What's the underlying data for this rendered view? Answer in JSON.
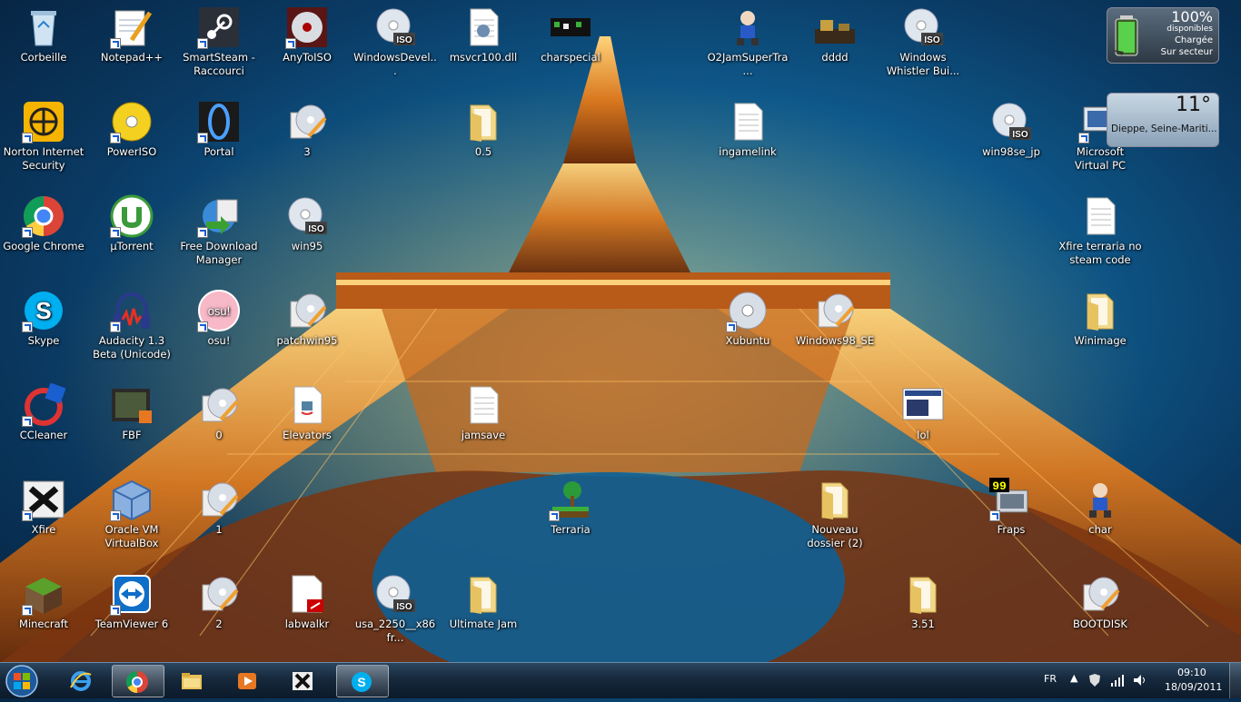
{
  "desktop_icons": [
    {
      "label": "Corbeille",
      "icon": "recycle-bin-icon"
    },
    {
      "label": "Notepad++",
      "icon": "notepad-plus-plus-icon"
    },
    {
      "label": "SmartSteam - Raccourci",
      "icon": "steam-icon"
    },
    {
      "label": "AnyToISO",
      "icon": "disc-red-icon"
    },
    {
      "label": "WindowsDevel...",
      "icon": "iso-disc-icon"
    },
    {
      "label": "msvcr100.dll",
      "icon": "dll-file-icon"
    },
    {
      "label": "charspecial",
      "icon": "pixel-art-icon"
    },
    {
      "label": "O2JamSuperTra...",
      "icon": "character-sprite-icon"
    },
    {
      "label": "dddd",
      "icon": "pixel-scene-icon"
    },
    {
      "label": "Windows Whistler Bui...",
      "icon": "iso-disc-icon"
    },
    {
      "label": "Norton Internet Security",
      "icon": "norton-icon"
    },
    {
      "label": "PowerISO",
      "icon": "poweriso-icon"
    },
    {
      "label": "Portal",
      "icon": "portal-icon"
    },
    {
      "label": "3",
      "icon": "disc-burn-icon"
    },
    {
      "label": "0.5",
      "icon": "folder-icon"
    },
    {
      "label": "ingamelink",
      "icon": "text-file-icon"
    },
    {
      "label": "win98se_jp",
      "icon": "iso-disc-icon"
    },
    {
      "label": "Microsoft Virtual PC",
      "icon": "virtual-pc-icon"
    },
    {
      "label": "Google Chrome",
      "icon": "chrome-icon"
    },
    {
      "label": "µTorrent",
      "icon": "utorrent-icon"
    },
    {
      "label": "Free Download Manager",
      "icon": "download-manager-icon"
    },
    {
      "label": "win95",
      "icon": "iso-disc-icon"
    },
    {
      "label": "Xfire terraria no steam code",
      "icon": "text-file-icon"
    },
    {
      "label": "Skype",
      "icon": "skype-icon"
    },
    {
      "label": "Audacity 1.3 Beta (Unicode)",
      "icon": "audacity-icon"
    },
    {
      "label": "osu!",
      "icon": "osu-icon"
    },
    {
      "label": "patchwin95",
      "icon": "disc-burn-icon"
    },
    {
      "label": "Xubuntu",
      "icon": "disc-icon"
    },
    {
      "label": "Windows98_SE",
      "icon": "disc-burn-icon"
    },
    {
      "label": "Winimage",
      "icon": "folder-icon"
    },
    {
      "label": "CCleaner",
      "icon": "ccleaner-icon"
    },
    {
      "label": "FBF",
      "icon": "video-file-icon"
    },
    {
      "label": "0",
      "icon": "disc-burn-icon"
    },
    {
      "label": "Elevators",
      "icon": "java-file-icon"
    },
    {
      "label": "jamsave",
      "icon": "text-file-icon"
    },
    {
      "label": "lol",
      "icon": "screenshot-file-icon"
    },
    {
      "label": "Xfire",
      "icon": "xfire-icon"
    },
    {
      "label": "Oracle VM VirtualBox",
      "icon": "virtualbox-icon"
    },
    {
      "label": "1",
      "icon": "disc-burn-icon"
    },
    {
      "label": "Terraria",
      "icon": "terraria-icon"
    },
    {
      "label": "Nouveau dossier (2)",
      "icon": "folder-icon"
    },
    {
      "label": "Fraps",
      "icon": "fraps-icon"
    },
    {
      "label": "char",
      "icon": "character-sprite-icon"
    },
    {
      "label": "Minecraft",
      "icon": "minecraft-icon"
    },
    {
      "label": "TeamViewer 6",
      "icon": "teamviewer-icon"
    },
    {
      "label": "2",
      "icon": "disc-burn-icon"
    },
    {
      "label": "labwalkr",
      "icon": "pdf-file-icon"
    },
    {
      "label": "usa_2250__x86fr...",
      "icon": "iso-disc-icon"
    },
    {
      "label": "Ultimate Jam",
      "icon": "folder-icon"
    },
    {
      "label": "3.51",
      "icon": "folder-icon"
    },
    {
      "label": "BOOTDISK",
      "icon": "disc-burn-icon"
    }
  ],
  "battery_gadget": {
    "percent": "100%",
    "available": "disponibles",
    "state": "Chargée",
    "source": "Sur secteur"
  },
  "weather_gadget": {
    "temperature": "11°",
    "location": "Dieppe, Seine-Mariti..."
  },
  "taskbar": {
    "language": "FR",
    "time": "09:10",
    "date": "18/09/2011",
    "pinned": [
      "internet-explorer-icon",
      "chrome-icon",
      "explorer-folder-icon",
      "media-player-icon",
      "xfire-icon",
      "skype-icon"
    ]
  },
  "colors": {
    "taskbar_top": "#2b4760",
    "taskbar_bottom": "#0c1a2a",
    "desktop_blue": "#0f5f93",
    "tower_orange": "#e08a25"
  }
}
